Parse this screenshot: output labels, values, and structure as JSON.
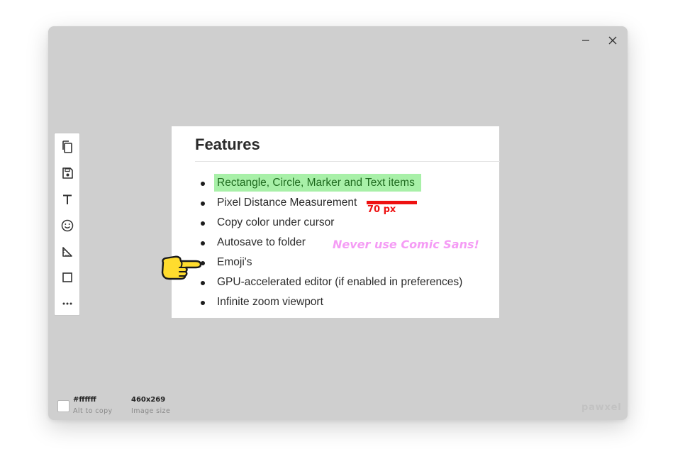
{
  "window": {
    "controls": {
      "minimize_icon": "minimize-icon",
      "close_icon": "close-icon"
    }
  },
  "toolbar": {
    "tools": [
      {
        "name": "copy-icon"
      },
      {
        "name": "save-icon"
      },
      {
        "name": "text-icon"
      },
      {
        "name": "emoji-icon"
      },
      {
        "name": "measure-icon"
      },
      {
        "name": "rectangle-icon"
      },
      {
        "name": "more-icon"
      }
    ]
  },
  "canvas": {
    "title": "Features",
    "features": [
      "Rectangle, Circle, Marker and Text items",
      "Pixel Distance Measurement",
      "Copy color under cursor",
      "Autosave to folder",
      "Emoji's",
      "GPU-accelerated editor (if enabled in preferences)",
      "Infinite zoom viewport"
    ],
    "highlight_color": "#a8f0a8",
    "measurement": {
      "label": "70 px",
      "color": "#ee1111"
    },
    "comic_text": "Never use Comic Sans!",
    "comic_color": "#f59cf5",
    "emoji": "pointing-hand-emoji"
  },
  "status": {
    "color_value": "#ffffff",
    "color_label": "Alt to copy",
    "size_value": "460x269",
    "size_label": "Image size"
  },
  "brand": "pawxel"
}
